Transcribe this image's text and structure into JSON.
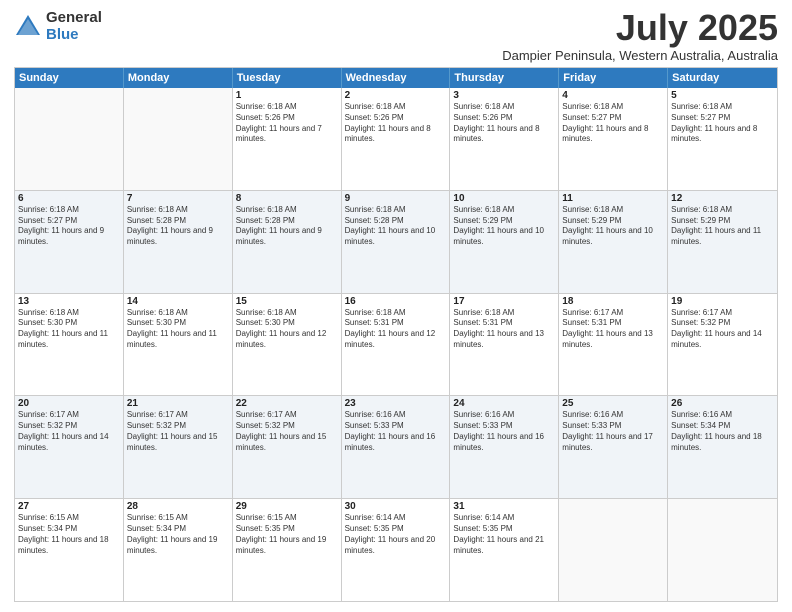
{
  "logo": {
    "general": "General",
    "blue": "Blue"
  },
  "title": "July 2025",
  "subtitle": "Dampier Peninsula, Western Australia, Australia",
  "days": [
    "Sunday",
    "Monday",
    "Tuesday",
    "Wednesday",
    "Thursday",
    "Friday",
    "Saturday"
  ],
  "weeks": [
    [
      {
        "day": "",
        "sunrise": "",
        "sunset": "",
        "daylight": ""
      },
      {
        "day": "",
        "sunrise": "",
        "sunset": "",
        "daylight": ""
      },
      {
        "day": "1",
        "sunrise": "Sunrise: 6:18 AM",
        "sunset": "Sunset: 5:26 PM",
        "daylight": "Daylight: 11 hours and 7 minutes."
      },
      {
        "day": "2",
        "sunrise": "Sunrise: 6:18 AM",
        "sunset": "Sunset: 5:26 PM",
        "daylight": "Daylight: 11 hours and 8 minutes."
      },
      {
        "day": "3",
        "sunrise": "Sunrise: 6:18 AM",
        "sunset": "Sunset: 5:26 PM",
        "daylight": "Daylight: 11 hours and 8 minutes."
      },
      {
        "day": "4",
        "sunrise": "Sunrise: 6:18 AM",
        "sunset": "Sunset: 5:27 PM",
        "daylight": "Daylight: 11 hours and 8 minutes."
      },
      {
        "day": "5",
        "sunrise": "Sunrise: 6:18 AM",
        "sunset": "Sunset: 5:27 PM",
        "daylight": "Daylight: 11 hours and 8 minutes."
      }
    ],
    [
      {
        "day": "6",
        "sunrise": "Sunrise: 6:18 AM",
        "sunset": "Sunset: 5:27 PM",
        "daylight": "Daylight: 11 hours and 9 minutes."
      },
      {
        "day": "7",
        "sunrise": "Sunrise: 6:18 AM",
        "sunset": "Sunset: 5:28 PM",
        "daylight": "Daylight: 11 hours and 9 minutes."
      },
      {
        "day": "8",
        "sunrise": "Sunrise: 6:18 AM",
        "sunset": "Sunset: 5:28 PM",
        "daylight": "Daylight: 11 hours and 9 minutes."
      },
      {
        "day": "9",
        "sunrise": "Sunrise: 6:18 AM",
        "sunset": "Sunset: 5:28 PM",
        "daylight": "Daylight: 11 hours and 10 minutes."
      },
      {
        "day": "10",
        "sunrise": "Sunrise: 6:18 AM",
        "sunset": "Sunset: 5:29 PM",
        "daylight": "Daylight: 11 hours and 10 minutes."
      },
      {
        "day": "11",
        "sunrise": "Sunrise: 6:18 AM",
        "sunset": "Sunset: 5:29 PM",
        "daylight": "Daylight: 11 hours and 10 minutes."
      },
      {
        "day": "12",
        "sunrise": "Sunrise: 6:18 AM",
        "sunset": "Sunset: 5:29 PM",
        "daylight": "Daylight: 11 hours and 11 minutes."
      }
    ],
    [
      {
        "day": "13",
        "sunrise": "Sunrise: 6:18 AM",
        "sunset": "Sunset: 5:30 PM",
        "daylight": "Daylight: 11 hours and 11 minutes."
      },
      {
        "day": "14",
        "sunrise": "Sunrise: 6:18 AM",
        "sunset": "Sunset: 5:30 PM",
        "daylight": "Daylight: 11 hours and 11 minutes."
      },
      {
        "day": "15",
        "sunrise": "Sunrise: 6:18 AM",
        "sunset": "Sunset: 5:30 PM",
        "daylight": "Daylight: 11 hours and 12 minutes."
      },
      {
        "day": "16",
        "sunrise": "Sunrise: 6:18 AM",
        "sunset": "Sunset: 5:31 PM",
        "daylight": "Daylight: 11 hours and 12 minutes."
      },
      {
        "day": "17",
        "sunrise": "Sunrise: 6:18 AM",
        "sunset": "Sunset: 5:31 PM",
        "daylight": "Daylight: 11 hours and 13 minutes."
      },
      {
        "day": "18",
        "sunrise": "Sunrise: 6:17 AM",
        "sunset": "Sunset: 5:31 PM",
        "daylight": "Daylight: 11 hours and 13 minutes."
      },
      {
        "day": "19",
        "sunrise": "Sunrise: 6:17 AM",
        "sunset": "Sunset: 5:32 PM",
        "daylight": "Daylight: 11 hours and 14 minutes."
      }
    ],
    [
      {
        "day": "20",
        "sunrise": "Sunrise: 6:17 AM",
        "sunset": "Sunset: 5:32 PM",
        "daylight": "Daylight: 11 hours and 14 minutes."
      },
      {
        "day": "21",
        "sunrise": "Sunrise: 6:17 AM",
        "sunset": "Sunset: 5:32 PM",
        "daylight": "Daylight: 11 hours and 15 minutes."
      },
      {
        "day": "22",
        "sunrise": "Sunrise: 6:17 AM",
        "sunset": "Sunset: 5:32 PM",
        "daylight": "Daylight: 11 hours and 15 minutes."
      },
      {
        "day": "23",
        "sunrise": "Sunrise: 6:16 AM",
        "sunset": "Sunset: 5:33 PM",
        "daylight": "Daylight: 11 hours and 16 minutes."
      },
      {
        "day": "24",
        "sunrise": "Sunrise: 6:16 AM",
        "sunset": "Sunset: 5:33 PM",
        "daylight": "Daylight: 11 hours and 16 minutes."
      },
      {
        "day": "25",
        "sunrise": "Sunrise: 6:16 AM",
        "sunset": "Sunset: 5:33 PM",
        "daylight": "Daylight: 11 hours and 17 minutes."
      },
      {
        "day": "26",
        "sunrise": "Sunrise: 6:16 AM",
        "sunset": "Sunset: 5:34 PM",
        "daylight": "Daylight: 11 hours and 18 minutes."
      }
    ],
    [
      {
        "day": "27",
        "sunrise": "Sunrise: 6:15 AM",
        "sunset": "Sunset: 5:34 PM",
        "daylight": "Daylight: 11 hours and 18 minutes."
      },
      {
        "day": "28",
        "sunrise": "Sunrise: 6:15 AM",
        "sunset": "Sunset: 5:34 PM",
        "daylight": "Daylight: 11 hours and 19 minutes."
      },
      {
        "day": "29",
        "sunrise": "Sunrise: 6:15 AM",
        "sunset": "Sunset: 5:35 PM",
        "daylight": "Daylight: 11 hours and 19 minutes."
      },
      {
        "day": "30",
        "sunrise": "Sunrise: 6:14 AM",
        "sunset": "Sunset: 5:35 PM",
        "daylight": "Daylight: 11 hours and 20 minutes."
      },
      {
        "day": "31",
        "sunrise": "Sunrise: 6:14 AM",
        "sunset": "Sunset: 5:35 PM",
        "daylight": "Daylight: 11 hours and 21 minutes."
      },
      {
        "day": "",
        "sunrise": "",
        "sunset": "",
        "daylight": ""
      },
      {
        "day": "",
        "sunrise": "",
        "sunset": "",
        "daylight": ""
      }
    ]
  ]
}
